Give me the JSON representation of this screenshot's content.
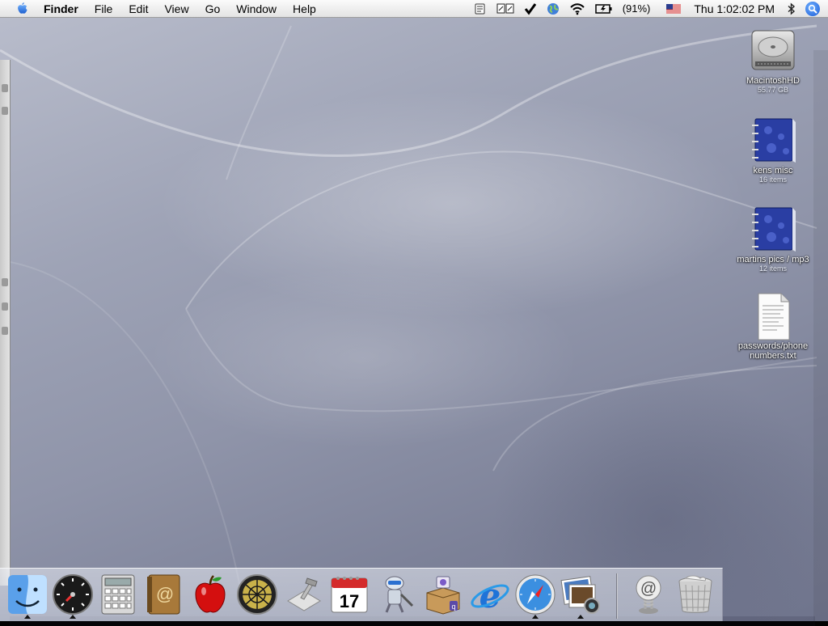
{
  "menubar": {
    "app_name": "Finder",
    "menus": [
      "File",
      "Edit",
      "View",
      "Go",
      "Window",
      "Help"
    ],
    "battery": "(91%)",
    "clock": "Thu 1:02:02 PM"
  },
  "desktop_icons": [
    {
      "name": "MacintoshHD",
      "sub": "55.77 GB",
      "icon": "hard-drive-icon"
    },
    {
      "name": "kens misc",
      "sub": "16 items",
      "icon": "notebook-folder-icon"
    },
    {
      "name": "martins pics / mp3",
      "sub": "12 items",
      "icon": "notebook-folder-icon"
    },
    {
      "name": "passwords/phone\nnumbers.txt",
      "sub": "",
      "icon": "text-document-icon"
    }
  ],
  "dock": {
    "items": [
      {
        "id": "finder",
        "icon": "finder-icon",
        "running": true
      },
      {
        "id": "dashboard",
        "icon": "dashboard-icon",
        "running": true
      },
      {
        "id": "calculator",
        "icon": "calculator-icon",
        "running": false
      },
      {
        "id": "address-book",
        "icon": "address-book-icon",
        "running": false
      },
      {
        "id": "apple-app",
        "icon": "red-apple-icon",
        "running": false
      },
      {
        "id": "network-utility",
        "icon": "globe-grid-icon",
        "running": false
      },
      {
        "id": "xcode-tools",
        "icon": "hammer-tool-icon",
        "running": false
      },
      {
        "id": "ical",
        "icon": "calendar-icon",
        "running": false,
        "label": "17"
      },
      {
        "id": "automator",
        "icon": "automator-robot-icon",
        "running": false
      },
      {
        "id": "quicktime-box",
        "icon": "package-box-icon",
        "running": false
      },
      {
        "id": "internet-explorer",
        "icon": "internet-explorer-icon",
        "running": false
      },
      {
        "id": "safari",
        "icon": "safari-compass-icon",
        "running": true
      },
      {
        "id": "iphoto",
        "icon": "iphoto-icon",
        "running": true
      },
      {
        "id": "mail-at",
        "icon": "at-sign-icon",
        "running": false
      },
      {
        "id": "trash",
        "icon": "trash-icon",
        "running": false
      }
    ]
  },
  "colors": {
    "wallpaper_light": "#b8bccb",
    "wallpaper_dark": "#6f748c",
    "accent_blue": "#1a5bd6"
  }
}
